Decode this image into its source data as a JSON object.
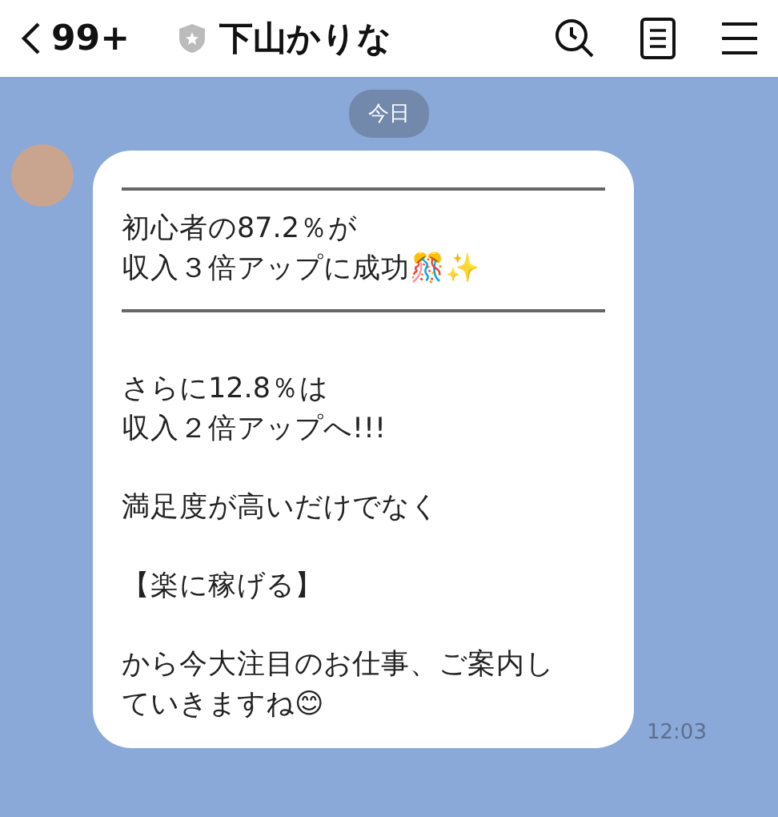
{
  "header": {
    "back_count": "99+",
    "title": "下山かりな"
  },
  "date_label": "今日",
  "message": {
    "blocks": [
      {
        "kind": "rule"
      },
      {
        "kind": "text",
        "lines": [
          "初心者の87.2％が",
          "収入３倍アップに成功🎊✨"
        ]
      },
      {
        "kind": "rule"
      },
      {
        "kind": "text",
        "lines": [
          "さらに12.8％は",
          "収入２倍アップへ!!!"
        ]
      },
      {
        "kind": "text",
        "lines": [
          "満足度が高いだけでなく"
        ]
      },
      {
        "kind": "text",
        "lines": [
          "【楽に稼げる】"
        ]
      },
      {
        "kind": "text",
        "lines": [
          "から今大注目のお仕事、ご案内し",
          "ていきますね😊"
        ]
      }
    ],
    "time": "12:03"
  }
}
